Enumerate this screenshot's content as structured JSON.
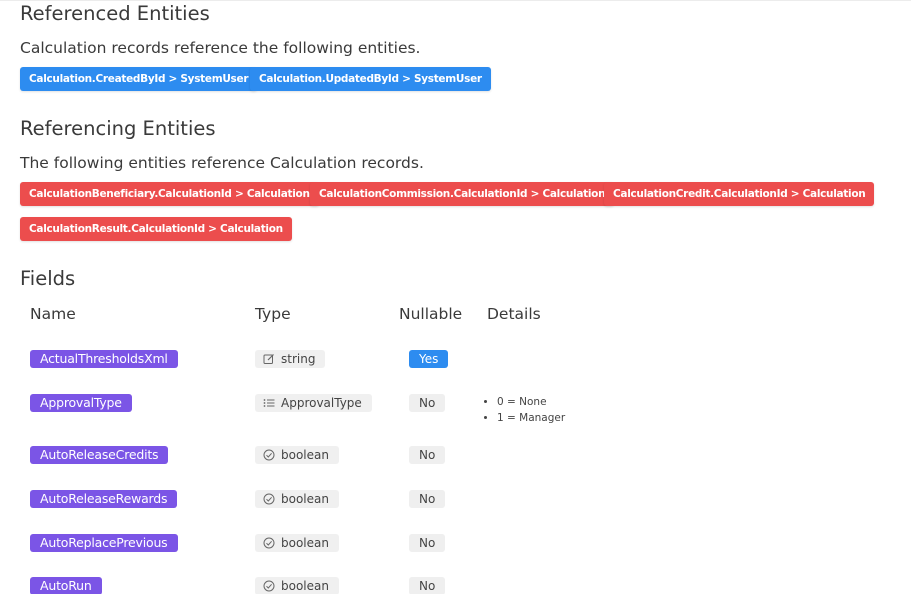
{
  "referenced": {
    "title": "Referenced Entities",
    "description": "Calculation records reference the following entities.",
    "tags": [
      "Calculation.CreatedById > SystemUser",
      "Calculation.UpdatedById > SystemUser"
    ]
  },
  "referencing": {
    "title": "Referencing Entities",
    "description": "The following entities reference Calculation records.",
    "tags": [
      "CalculationBeneficiary.CalculationId > Calculation",
      "CalculationCommission.CalculationId > Calculation",
      "CalculationCredit.CalculationId > Calculation",
      "CalculationResult.CalculationId > Calculation"
    ]
  },
  "fields": {
    "title": "Fields",
    "headers": {
      "name": "Name",
      "type": "Type",
      "nullable": "Nullable",
      "details": "Details"
    },
    "rows": [
      {
        "name": "ActualThresholdsXml",
        "type": "string",
        "type_icon": "edit-icon",
        "nullable": "Yes",
        "details": []
      },
      {
        "name": "ApprovalType",
        "type": "ApprovalType",
        "type_icon": "list-icon",
        "nullable": "No",
        "details": [
          "0 = None",
          "1 = Manager"
        ]
      },
      {
        "name": "AutoReleaseCredits",
        "type": "boolean",
        "type_icon": "check-circle-icon",
        "nullable": "No",
        "details": []
      },
      {
        "name": "AutoReleaseRewards",
        "type": "boolean",
        "type_icon": "check-circle-icon",
        "nullable": "No",
        "details": []
      },
      {
        "name": "AutoReplacePrevious",
        "type": "boolean",
        "type_icon": "check-circle-icon",
        "nullable": "No",
        "details": []
      },
      {
        "name": "AutoRun",
        "type": "boolean",
        "type_icon": "check-circle-icon",
        "nullable": "No",
        "details": []
      }
    ]
  },
  "colors": {
    "blue_tag": "#2d8cf0",
    "red_tag": "#ec4d4d",
    "name_chip": "#7b55e6"
  }
}
